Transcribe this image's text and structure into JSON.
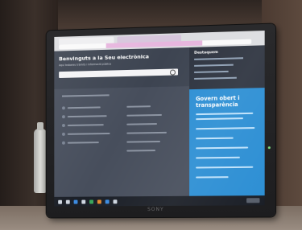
{
  "screen": {
    "hero": {
      "title": "Benvinguts a la Seu electrònica",
      "subtitle": "Aquí trobareu tràmits i informació pública"
    },
    "sidebar": {
      "title": "Destaquem"
    },
    "panel": {
      "title_line1": "Govern obert i",
      "title_line2": "transparència"
    },
    "monitor_brand": "SONY"
  },
  "colors": {
    "hero_bg": "#3d4451",
    "panel_blue": "#2d8fd4",
    "taskbar": "#1b1f27"
  }
}
